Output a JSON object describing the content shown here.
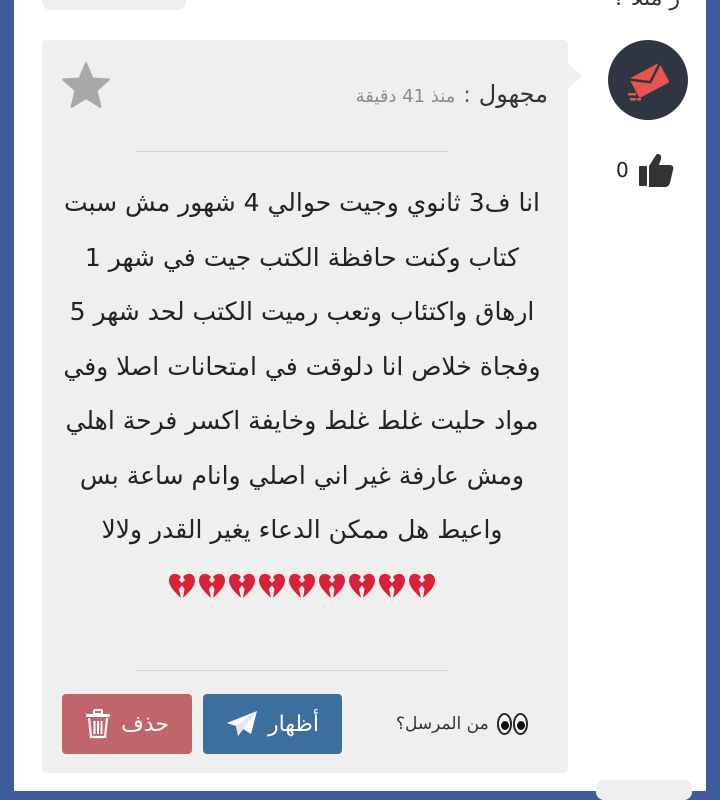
{
  "top_partial_text": "ر ﻣﺜﻼ ؟",
  "post": {
    "author": "مجهول",
    "separator": ":",
    "time": "منذ 41 دقيقة",
    "message": "انا ف3 ثانوي وجيت حوالي 4 شهور مش سبت كتاب وكنت حافظة الكتب جيت في شهر 1 ارهاق واكتئاب وتعب رميت الكتب لحد شهر 5 وفجاة خلاص انا دلوقت في امتحانات اصلا وفي مواد حليت غلط غلط وخايفة اكسر فرحة اهلي ومش عارفة غير اني اصلي وانام ساعة بس واعيط هل ممكن الدعاء يغير القدر ولالا",
    "emoji_count": 9,
    "likes": "0",
    "show_button": "أظهار",
    "delete_button": "حذف",
    "sender_label": "من المرسل؟"
  },
  "colors": {
    "page_border": "#3e5c9a",
    "card": "#efefef",
    "show_button": "#3c6e9e",
    "delete_button": "#c0666a",
    "avatar_bg": "#2f3541",
    "avatar_accent": "#e8554e"
  },
  "icons": [
    "star-icon",
    "envelope-logo-icon",
    "thumbs-up-icon",
    "broken-heart-icon",
    "paper-plane-icon",
    "trash-icon",
    "eyes-icon"
  ]
}
